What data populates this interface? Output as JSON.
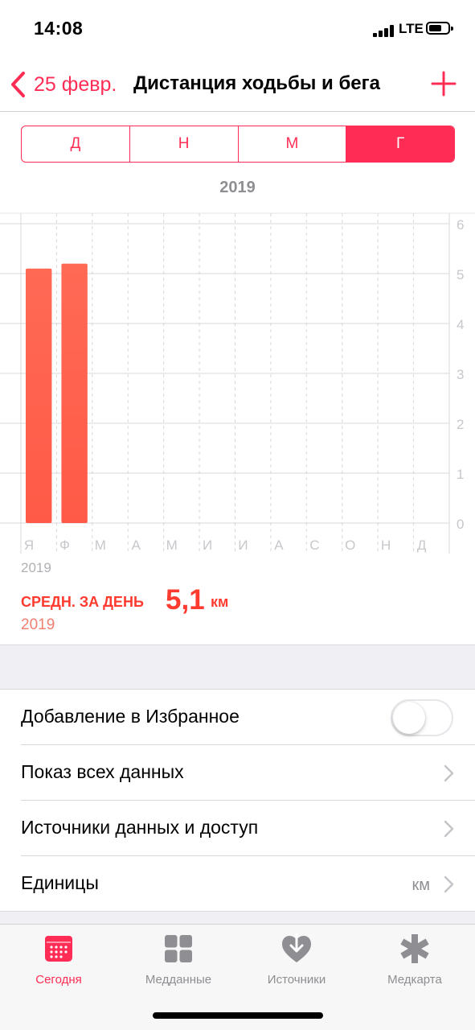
{
  "status_bar": {
    "time": "14:08",
    "network": "LTE"
  },
  "nav": {
    "back_label": "25 февр.",
    "title": "Дистанция ходьбы и бега"
  },
  "segments": [
    {
      "label": "Д",
      "active": false
    },
    {
      "label": "Н",
      "active": false
    },
    {
      "label": "М",
      "active": false
    },
    {
      "label": "Г",
      "active": true
    }
  ],
  "period_header": "2019",
  "chart_data": {
    "type": "bar",
    "categories": [
      "Я",
      "Ф",
      "М",
      "А",
      "М",
      "И",
      "И",
      "А",
      "С",
      "О",
      "Н",
      "Д"
    ],
    "values": [
      5.1,
      5.2,
      null,
      null,
      null,
      null,
      null,
      null,
      null,
      null,
      null,
      null
    ],
    "ylim": [
      0,
      6
    ],
    "yticks": [
      "0",
      "1",
      "2",
      "3",
      "4",
      "5",
      "6"
    ],
    "x_sub_label": "2019",
    "bar_color": "#ff5a47",
    "grid": true
  },
  "summary": {
    "label": "СРЕДН. ЗА ДЕНЬ",
    "value": "5,1",
    "unit": "км",
    "period": "2019"
  },
  "settings": {
    "favorite_label": "Добавление в Избранное",
    "favorite_on": false,
    "show_all_label": "Показ всех данных",
    "sources_label": "Источники данных и доступ",
    "units_label": "Единицы",
    "units_value": "км"
  },
  "tabs": [
    {
      "label": "Сегодня",
      "icon": "calendar-icon",
      "active": true
    },
    {
      "label": "Медданные",
      "icon": "grid-icon",
      "active": false
    },
    {
      "label": "Источники",
      "icon": "heart-download-icon",
      "active": false
    },
    {
      "label": "Медкарта",
      "icon": "asterisk-icon",
      "active": false
    }
  ],
  "colors": {
    "accent": "#ff2d55",
    "bar": "#ff5a47",
    "summary": "#ff3b30"
  }
}
